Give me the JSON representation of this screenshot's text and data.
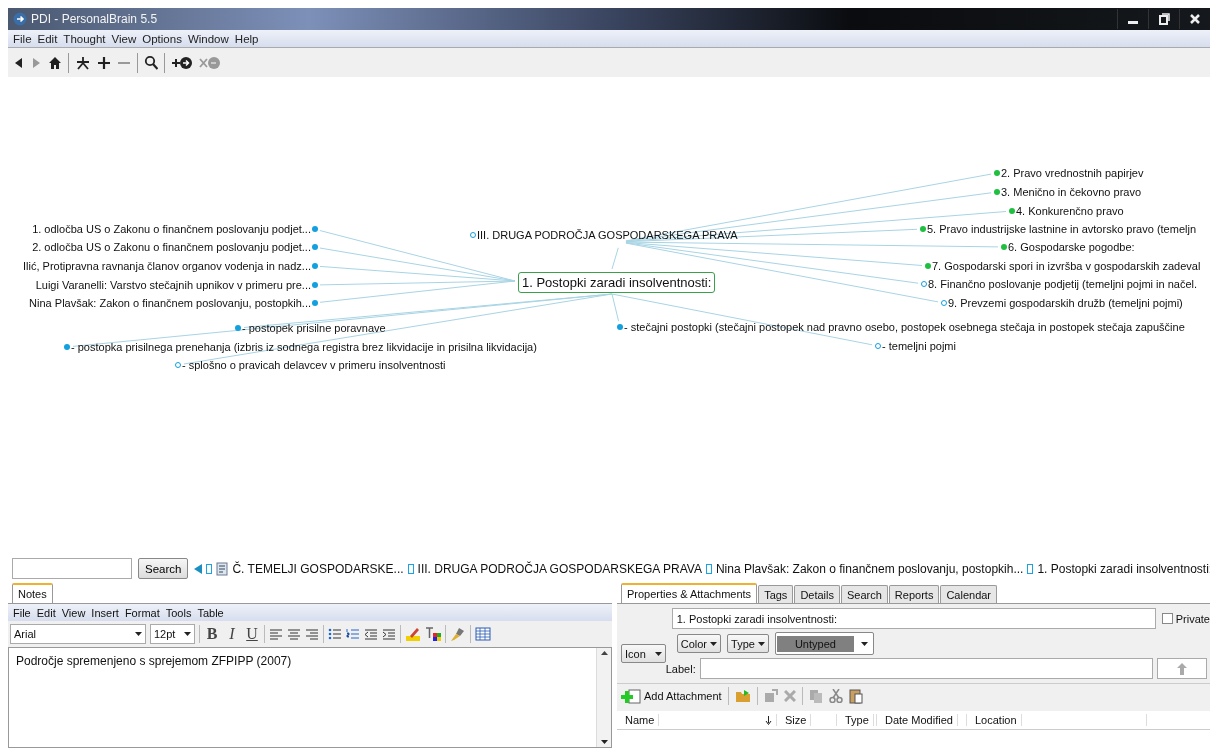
{
  "window": {
    "title": "PDI - PersonalBrain 5.5"
  },
  "menu": [
    "File",
    "Edit",
    "Thought",
    "View",
    "Options",
    "Window",
    "Help"
  ],
  "brain": {
    "parent": {
      "label": "III. DRUGA PODROČJA GOSPODARSKEGA PRAVA",
      "has_children": false
    },
    "active": {
      "label": "1.  Postopki zaradi insolventnosti:"
    },
    "jumps": [
      {
        "label": "1. odločba US o Zakonu o finančnem poslovanju podjet..."
      },
      {
        "label": "2. odločba US o Zakonu o finančnem poslovanju podjet..."
      },
      {
        "label": "Ilić, Protipravna ravnanja članov organov vodenja in nadz..."
      },
      {
        "label": "Luigi Varanelli: Varstvo stečajnih upnikov v primeru pre..."
      },
      {
        "label": "Nina Plavšak: Zakon o finančnem poslovanju, postopkih..."
      }
    ],
    "children": [
      {
        "label": "- postopek prisilne poravnave",
        "has_children": true
      },
      {
        "label": "- stečajni postopki (stečajni postopek nad pravno osebo, postopek osebnega stečaja in postopek stečaja zapuščine",
        "has_children": true
      },
      {
        "label": "- postopka prisilnega prenehanja (izbris iz sodnega registra brez likvidacije in prisilna likvidacija)",
        "has_children": true
      },
      {
        "label": "- temeljni pojmi",
        "has_children": false
      },
      {
        "label": "- splošno o pravicah delavcev v primeru insolventnosti",
        "has_children": false
      }
    ],
    "siblings": [
      {
        "label": "2. Pravo vrednostnih papirjev",
        "has_children": true
      },
      {
        "label": "3.  Menično in čekovno pravo",
        "has_children": true
      },
      {
        "label": "4.  Konkurenčno pravo",
        "has_children": true
      },
      {
        "label": "5.  Pravo industrijske lastnine in avtorsko pravo (temeljn",
        "has_children": true
      },
      {
        "label": "6. Gospodarske pogodbe:",
        "has_children": true
      },
      {
        "label": "7. Gospodarski spori in izvršba v gospodarskih zadeval",
        "has_children": true
      },
      {
        "label": "8. Finančno poslovanje podjetij (temeljni pojmi in načel.",
        "has_children": false
      },
      {
        "label": "9. Prevzemi gospodarskih družb (temeljni pojmi)",
        "has_children": false
      }
    ]
  },
  "search": {
    "button": "Search"
  },
  "breadcrumb": [
    {
      "label": "Č. TEMELJI GOSPODARSKE...",
      "kind": "document"
    },
    {
      "label": "III. DRUGA PODROČJA GOSPODARSKEGA PRAVA",
      "kind": "thought"
    },
    {
      "label": "Nina Plavšak: Zakon o finančnem poslovanju, postopkih...",
      "kind": "thought"
    },
    {
      "label": "1.  Postopki zaradi insolventnosti:",
      "kind": "thought"
    }
  ],
  "notes": {
    "tab": "Notes",
    "menu": [
      "File",
      "Edit",
      "View",
      "Insert",
      "Format",
      "Tools",
      "Table"
    ],
    "font": "Arial",
    "size": "12pt",
    "format_buttons": [
      "B",
      "I",
      "U"
    ],
    "text": "Področje spremenjeno s sprejemom ZFPIPP (2007)"
  },
  "properties": {
    "tabs": [
      {
        "label": "Properties & Attachments",
        "selected": true
      },
      {
        "label": "Tags",
        "selected": false
      },
      {
        "label": "Details",
        "selected": false
      },
      {
        "label": "Search",
        "selected": false
      },
      {
        "label": "Reports",
        "selected": false
      },
      {
        "label": "Calendar",
        "selected": false
      }
    ],
    "name": "1.  Postopki zaradi insolventnosti:",
    "private": {
      "label": "Private",
      "checked": false
    },
    "icon": "Icon",
    "color_label": "Color",
    "type": "Type",
    "type_value": "Untyped",
    "label_caption": "Label:",
    "add_attachment": "Add Attachment",
    "columns": [
      "Name",
      "Size",
      "Type",
      "Date Modified",
      "Location"
    ]
  }
}
